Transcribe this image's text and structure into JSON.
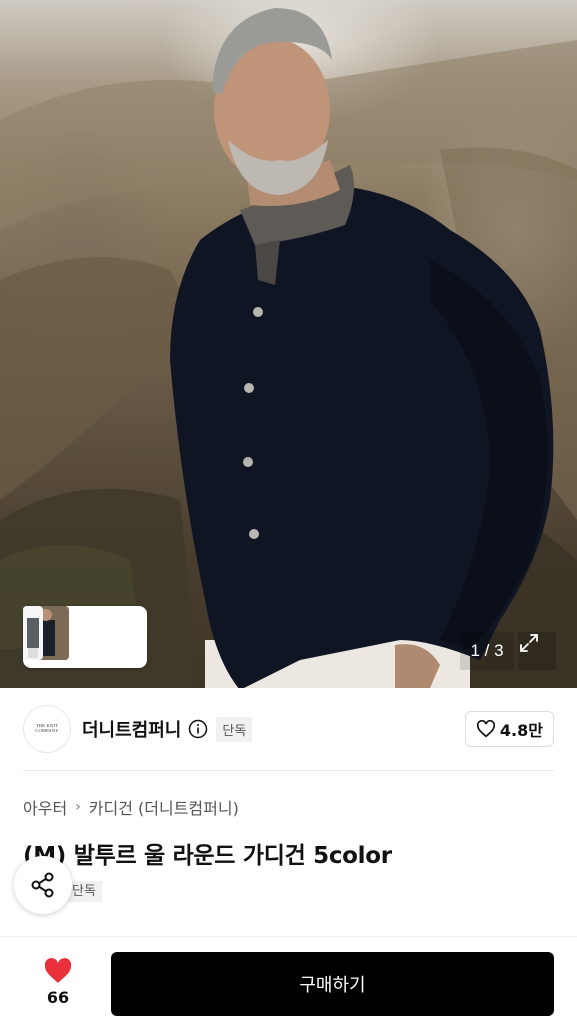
{
  "hero": {
    "image_description_icon": "product-photo-man-cardigan",
    "image_counter": "1 / 3",
    "thumbnail_strip": {
      "ai_label": "AI",
      "chevron": "›"
    }
  },
  "brand": {
    "logo_text": "THE KNIT COMPANY",
    "name": "더니트컴퍼니",
    "exclusive_badge": "단독",
    "like_count": "4.8만"
  },
  "breadcrumb": {
    "items": [
      "아우터",
      "카디건 (더니트컴퍼니)"
    ],
    "separator": "›"
  },
  "product": {
    "title": "(M) 발투르 울 라운드 가디건 5color",
    "badge": "단독"
  },
  "bottom_bar": {
    "wish_count": "66",
    "buy_label": "구매하기"
  },
  "colors": {
    "accent_red": "#e8303a",
    "buy_button": "#000000"
  }
}
